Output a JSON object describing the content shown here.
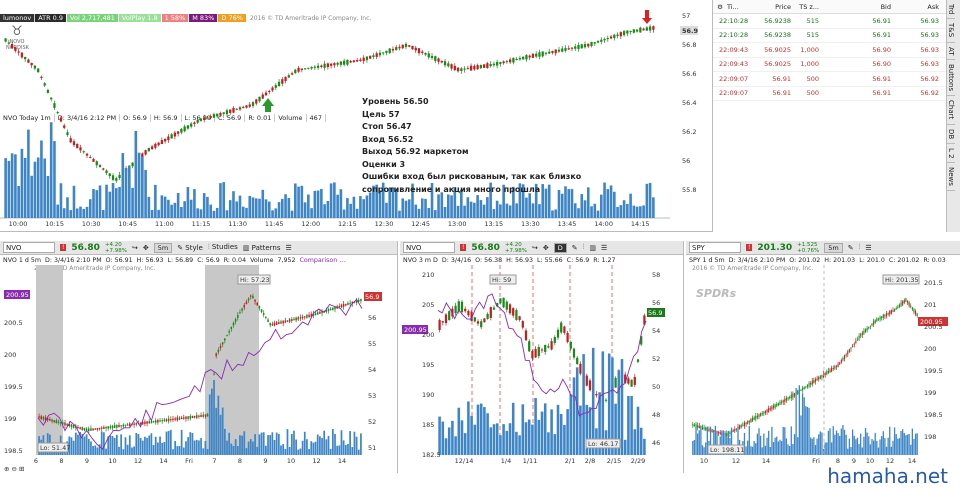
{
  "top": {
    "username": "lumonov",
    "indicators": [
      {
        "label": "ATR 0.9",
        "color": "#2a2a2a"
      },
      {
        "label": "Vol 2,717,481",
        "color": "#7ad27a"
      },
      {
        "label": "VolPlay 1.8",
        "color": "#9adf9a"
      },
      {
        "label": "1 58%",
        "color": "#f08080"
      },
      {
        "label": "M 83%",
        "color": "#7a1a7a"
      },
      {
        "label": "D 76%",
        "color": "#f0a020"
      }
    ],
    "copyright": "2016 © TD Ameritrade IP Company, Inc.",
    "logo": "NOVO NORDISK",
    "title": "NVO Today 1m",
    "date": "D: 3/4/16 2:12 PM",
    "o": "O: 56.9",
    "h": "H: 56.9",
    "l": "L: 56.89",
    "c": "C: 56.9",
    "r": "R: 0.01",
    "volume_label": "Volume",
    "volume": "467",
    "y_ticks": [
      "57",
      "56.8",
      "56.6",
      "56.4",
      "56.2",
      "56",
      "55.8"
    ],
    "last_price": "56.9",
    "x_ticks": [
      "10:00",
      "10:15",
      "10:30",
      "10:45",
      "11:00",
      "11:15",
      "11:30",
      "11:45",
      "12:00",
      "12:15",
      "12:30",
      "12:45",
      "13:00",
      "13:15",
      "13:30",
      "13:45",
      "14:00",
      "14:15"
    ],
    "annotation": [
      "Уровень  56.50",
      "Цель 57",
      "Стоп 56.47",
      "Вход 56.52",
      "Выход 56.92 маркетом",
      "Оценки 3",
      "Ошибки вход был рискованым, так как близко",
      "сопротивление и акция много прошла"
    ]
  },
  "time_sales": {
    "columns": [
      "Ti...",
      "Price",
      "TS z...",
      "Bid",
      "Ask"
    ],
    "rows": [
      {
        "time": "22:10:28",
        "price": "56.9238",
        "size": "515",
        "bid": "56.91",
        "ask": "56.93",
        "up": true
      },
      {
        "time": "22:10:28",
        "price": "56.9238",
        "size": "515",
        "bid": "56.91",
        "ask": "56.93",
        "up": true
      },
      {
        "time": "22:09:43",
        "price": "56.9025",
        "size": "1,000",
        "bid": "56.90",
        "ask": "56.93",
        "up": false
      },
      {
        "time": "22:09:43",
        "price": "56.9025",
        "size": "1,000",
        "bid": "56.90",
        "ask": "56.93",
        "up": false
      },
      {
        "time": "22:09:07",
        "price": "56.91",
        "size": "500",
        "bid": "56.91",
        "ask": "56.92",
        "up": false
      },
      {
        "time": "22:09:07",
        "price": "56.91",
        "size": "500",
        "bid": "56.91",
        "ask": "56.92",
        "up": false
      }
    ],
    "side_tabs": [
      "Trd",
      "T&S",
      "AT",
      "Buttons",
      "Chart",
      "DB",
      "L 2",
      "News"
    ]
  },
  "panel1": {
    "symbol": "NVO",
    "price": "56.80",
    "chg1": "+4.20",
    "chg2": "+7.98%",
    "period": "5m",
    "style_label": "Style",
    "studies_label": "Studies",
    "patterns_label": "Patterns",
    "info": "NVO 1 d 5m",
    "date": "D: 3/4/16 2:10 PM",
    "o": "O: 56.91",
    "h": "H: 56.93",
    "l": "L: 56.89",
    "c": "C: 56.9",
    "r": "R: 0.04",
    "volume_label": "Volume",
    "volume": "7,952",
    "comparison": "Comparison ...",
    "copyright": "2016 © TD Ameritrade IP Company, Inc.",
    "left_tag": "200.95",
    "right_tag": "56.9",
    "hi": "Hi: 57.23",
    "lo": "Lo: 51.47",
    "y_left": [
      "200.5",
      "200",
      "199.5",
      "199",
      "198.5"
    ],
    "y_right": [
      "56",
      "55",
      "54",
      "53",
      "52",
      "51"
    ],
    "x_ticks": [
      "6",
      "8",
      "9",
      "10",
      "12",
      "14",
      "Fri",
      "7",
      "8",
      "9",
      "10",
      "12",
      "14"
    ]
  },
  "panel2": {
    "symbol": "NVO",
    "price": "56.80",
    "chg1": "+4.20",
    "chg2": "+7.98%",
    "period": "D",
    "info": "NVO 3 m D",
    "date": "D: 3/4/16",
    "o": "O: 56.38",
    "h": "H: 56.93",
    "l": "L: 55.66",
    "c": "C: 56.9",
    "r": "R: 1.27",
    "left_tag": "200.95",
    "right_tag": "56.9",
    "hi": "Hi: 59",
    "lo": "Lo: 46.17",
    "y_left": [
      "210",
      "205",
      "200",
      "195",
      "190",
      "185",
      "182.5"
    ],
    "y_right": [
      "58",
      "56",
      "54",
      "52",
      "50",
      "48",
      "46"
    ],
    "x_ticks": [
      "12/14",
      "1/4",
      "1/11",
      "2/1",
      "2/8",
      "2/15",
      "2/29"
    ]
  },
  "panel3": {
    "symbol": "SPY",
    "price": "201.30",
    "chg1": "+1.525",
    "chg2": "+0.76%",
    "period": "5m",
    "info": "SPY 1 d 5m",
    "date": "D: 3/4/16 2:10 PM",
    "o": "O: 201.02",
    "h": "H: 201.03",
    "l": "L: 201.0",
    "c": "C: 201.02",
    "r": "R: 0.03",
    "copyright": "2016 © TD Ameritrade IP Company, Inc.",
    "logo": "SPDRs",
    "right_tag": "200.95",
    "hi": "Hi: 201.35",
    "lo": "Lo: 198.11",
    "y_right": [
      "201.5",
      "201",
      "200.5",
      "200",
      "199.5",
      "199",
      "198.5",
      "198"
    ],
    "x_ticks": [
      "10",
      "12",
      "14",
      "Fri",
      "8",
      "9",
      "10",
      "12",
      "14"
    ]
  },
  "watermark": "hamaha.net",
  "colors": {
    "up": "#1a8a1a",
    "down": "#c02020",
    "volume": "#3d85c6",
    "comparison": "#8a2ab0"
  }
}
